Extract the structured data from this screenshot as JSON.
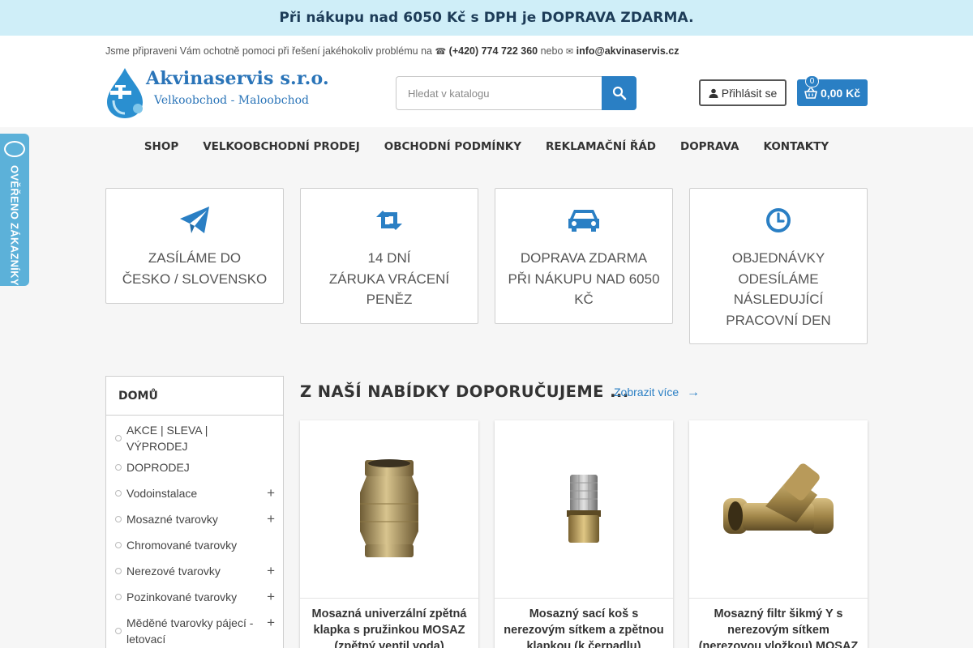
{
  "promo": {
    "text": "Při nákupu nad 6050 Kč s DPH je DOPRAVA ZDARMA."
  },
  "header": {
    "help_text": "Jsme připraveni Vám ochotně pomoci při řešení jakéhokoliv problému na",
    "phone": "(+420) 774 722 360",
    "or_text": "nebo",
    "email": "info@akvinaservis.cz",
    "logo_title": "Akvinaservis s.r.o.",
    "logo_subtitle": "Velkoobchod - Maloobchod",
    "search_placeholder": "Hledat v katalogu",
    "login_label": "Přihlásit se",
    "cart_total": "0,00 Kč",
    "cart_count": "0",
    "phone_icon": "phone-icon",
    "email_icon": "envelope-icon",
    "search_icon": "magnifier-icon",
    "user_icon": "user-icon",
    "cart_icon": "basket-icon"
  },
  "nav": {
    "items": [
      {
        "label": "SHOP"
      },
      {
        "label": "VELKOOBCHODNÍ PRODEJ"
      },
      {
        "label": "OBCHODNÍ PODMÍNKY"
      },
      {
        "label": "REKLAMAČNÍ ŘÁD"
      },
      {
        "label": "DOPRAVA"
      },
      {
        "label": "KONTAKTY"
      }
    ]
  },
  "side_tab": {
    "label": "OVĚŘENO ZÁKAZNÍKY"
  },
  "features": [
    {
      "icon": "paper-plane-icon",
      "line1": "ZASÍLÁME DO",
      "line2": "ČESKO / SLOVENSKO",
      "line3": "",
      "line4": ""
    },
    {
      "icon": "retweet-arrows-icon",
      "line1": "14 DNÍ",
      "line2": "ZÁRUKA VRÁCENÍ",
      "line3": "PENĚZ",
      "line4": ""
    },
    {
      "icon": "car-icon",
      "line1": "DOPRAVA ZDARMA",
      "line2": "PŘI NÁKUPU NAD 6050",
      "line3": "Kč",
      "line4": ""
    },
    {
      "icon": "clock-icon",
      "line1": "OBJEDNÁVKY",
      "line2": "ODESÍLÁME",
      "line3": "NÁSLEDUJÍCÍ",
      "line4": "PRACOVNÍ DEN"
    }
  ],
  "sidebar": {
    "heading": "DOMŮ",
    "items": [
      {
        "label": "AKCE | SLEVA | VÝPRODEJ",
        "expandable": false
      },
      {
        "label": "DOPRODEJ",
        "expandable": false
      },
      {
        "label": "Vodoinstalace",
        "expandable": true
      },
      {
        "label": "Mosazné tvarovky",
        "expandable": true
      },
      {
        "label": "Chromované tvarovky",
        "expandable": false
      },
      {
        "label": "Nerezové tvarovky",
        "expandable": true
      },
      {
        "label": "Pozinkované tvarovky",
        "expandable": true
      },
      {
        "label": "Měděné tvarovky pájecí - letovací",
        "expandable": true
      }
    ],
    "expand_symbol": "+"
  },
  "main": {
    "section_title": "Z NAŠÍ NABÍDKY DOPORUČUJEME ...",
    "see_more": "Zobrazit více",
    "see_more_arrow": "→",
    "products": [
      {
        "name": "Mosazná univerzální zpětná klapka s pružinkou MOSAZ (zpětný ventil voda)",
        "image": "check-valve-image"
      },
      {
        "name": "Mosazný sací koš s nerezovým sítkem a zpětnou klapkou (k čerpadlu)",
        "image": "suction-strainer-image"
      },
      {
        "name": "Mosazný filtr šikmý Y s nerezovým sítkem (nerezovou vložkou) MOSAZ",
        "image": "y-strainer-image"
      }
    ]
  },
  "colors": {
    "accent": "#2a7fc4",
    "promo_bg": "#cfeef8",
    "logo_blue": "#2a74b8",
    "side_tab": "#5cb1d9"
  }
}
